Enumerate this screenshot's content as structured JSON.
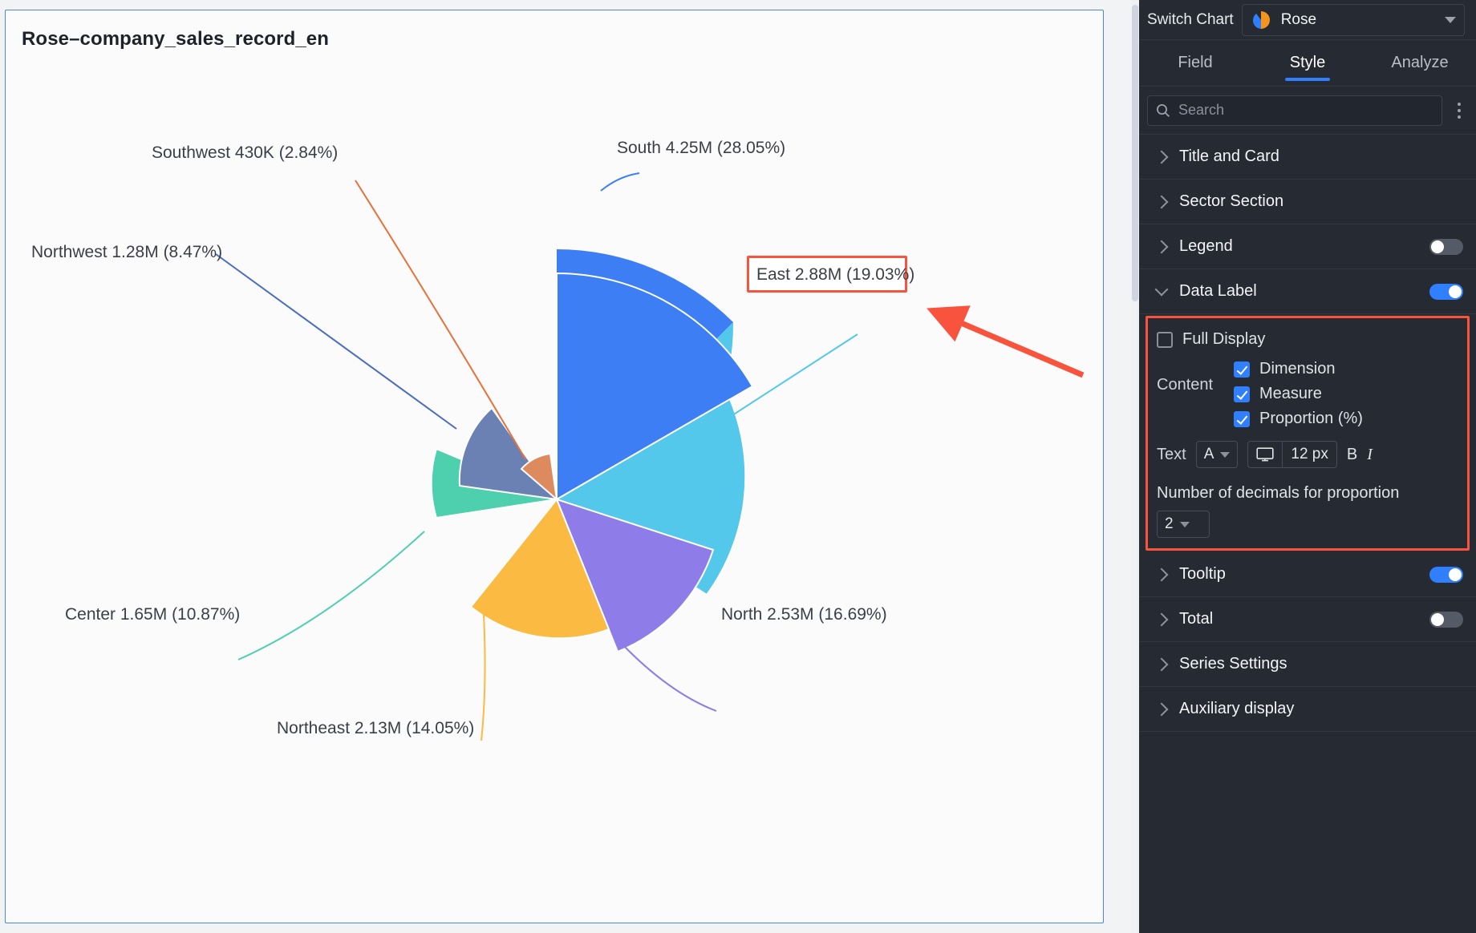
{
  "chart_card": {
    "title": "Rose–company_sales_record_en",
    "border_color": "#4a86e8"
  },
  "chart_data": {
    "type": "pie",
    "variant": "rose",
    "title": "Rose–company_sales_record_en",
    "xlabel": "",
    "ylabel": "",
    "legend": "off",
    "grid": false,
    "label_format": "{dimension} {measure} ({proportion}%)",
    "categories": [
      "South",
      "East",
      "North",
      "Northeast",
      "Center",
      "Northwest",
      "Southwest"
    ],
    "values": [
      4250000,
      2880000,
      2530000,
      2130000,
      1650000,
      1280000,
      430000
    ],
    "value_labels": [
      "4.25M",
      "2.88M",
      "2.53M",
      "2.13M",
      "1.65M",
      "1.28M",
      "430K"
    ],
    "proportions": [
      28.05,
      19.03,
      16.69,
      14.05,
      10.87,
      8.47,
      2.84
    ],
    "colors": [
      "#3d7ef5",
      "#53c8ea",
      "#8e7ce8",
      "#fbba42",
      "#4ecfae",
      "#6b80b3",
      "#dd8b5e"
    ],
    "labels": [
      "South 4.25M (28.05%)",
      "East 2.88M (19.03%)",
      "North 2.53M (16.69%)",
      "Northeast 2.13M (14.05%)",
      "Center 1.65M (10.87%)",
      "Northwest 1.28M (8.47%)",
      "Southwest 430K (2.84%)"
    ]
  },
  "sidebar": {
    "switch_chart_label": "Switch Chart",
    "chart_type_name": "Rose",
    "tabs": [
      {
        "label": "Field",
        "active": false
      },
      {
        "label": "Style",
        "active": true
      },
      {
        "label": "Analyze",
        "active": false
      }
    ],
    "search_placeholder": "Search",
    "search_value": "",
    "sections": [
      {
        "label": "Title and Card",
        "expanded": false,
        "toggle": null
      },
      {
        "label": "Sector Section",
        "expanded": false,
        "toggle": null
      },
      {
        "label": "Legend",
        "expanded": false,
        "toggle": "off"
      },
      {
        "label": "Data Label",
        "expanded": true,
        "toggle": "on"
      }
    ],
    "sections_after": [
      {
        "label": "Tooltip",
        "expanded": false,
        "toggle": "on"
      },
      {
        "label": "Total",
        "expanded": false,
        "toggle": "off"
      },
      {
        "label": "Series Settings",
        "expanded": false,
        "toggle": null
      },
      {
        "label": "Auxiliary display",
        "expanded": false,
        "toggle": null
      }
    ],
    "data_label": {
      "full_display_label": "Full Display",
      "full_display_checked": false,
      "content_label": "Content",
      "content_options": [
        {
          "label": "Dimension",
          "checked": true
        },
        {
          "label": "Measure",
          "checked": true
        },
        {
          "label": "Proportion (%)",
          "checked": true
        }
      ],
      "text_label": "Text",
      "font_value": "A",
      "size_value": "12 px",
      "bold_label": "B",
      "italic_label": "I",
      "decimals_title": "Number of decimals for proportion",
      "decimals_value": "2"
    },
    "accent_color": "#2f7fff",
    "highlight_color": "#f8533c"
  }
}
